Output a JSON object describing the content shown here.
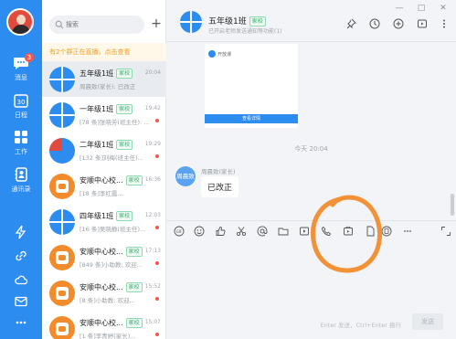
{
  "colors": {
    "nav_blue": "#2d8cf0",
    "tag_green": "#2fb36b",
    "unread_red": "#f5554a",
    "annotation_orange": "#f28b2c"
  },
  "nav": {
    "badge": "3",
    "items": [
      {
        "label": "消息",
        "icon": "chat-bubble-icon"
      },
      {
        "label": "日程",
        "icon": "calendar-30-icon"
      },
      {
        "label": "工作",
        "icon": "apps-grid-icon"
      },
      {
        "label": "通讯录",
        "icon": "contacts-book-icon"
      }
    ],
    "bottom_icons": [
      "lightning-icon",
      "link-icon",
      "cloud-icon",
      "mail-icon",
      "more-dots-icon"
    ]
  },
  "list": {
    "search_placeholder": "搜索",
    "add_label": "+",
    "banner": "有2个群正在直播，点击查看",
    "conversations": [
      {
        "name": "五年级1班",
        "tag": "家校",
        "time": "20:04",
        "preview": "周晨致(家长): 已改正",
        "avatar": "grid",
        "unread": false,
        "active": true
      },
      {
        "name": "一年级1班",
        "tag": "家校",
        "time": "19:42",
        "preview": "[78 条]张晓芳(班主任): ...",
        "avatar": "grid",
        "unread": true,
        "active": false
      },
      {
        "name": "二年级1班",
        "tag": "家校",
        "time": "19:29",
        "preview": "[132 条]刘梅(班主任)...",
        "avatar": "photo",
        "unread": true,
        "active": false
      },
      {
        "name": "安顺中心校...",
        "tag": "家校",
        "time": "16:36",
        "preview": "[18 条]李红霞...",
        "avatar": "orange",
        "unread": false,
        "active": false
      },
      {
        "name": "四年级1班",
        "tag": "家校",
        "time": "12:03",
        "preview": "[16 条]吴晓静(班主任)...",
        "avatar": "grid",
        "unread": true,
        "active": false
      },
      {
        "name": "安顺中心校...",
        "tag": "家校",
        "time": "17:13",
        "preview": "[849 条]小助教: 欢迎...",
        "avatar": "orange",
        "unread": true,
        "active": false
      },
      {
        "name": "安顺中心校...",
        "tag": "家校",
        "time": "15:52",
        "preview": "[8 条]小助教: 欢迎...",
        "avatar": "orange",
        "unread": true,
        "active": false
      },
      {
        "name": "安顺中心校...",
        "tag": "家校",
        "time": "15:07",
        "preview": "[1 条]李青婷(家长)...",
        "avatar": "orange",
        "unread": true,
        "active": false
      }
    ]
  },
  "chat": {
    "title": "五年级1班",
    "title_tag": "家校",
    "subtitle": "已开启老师发送通知等功能(1)",
    "header_icons": [
      "pin-icon",
      "clock-icon",
      "add-member-icon",
      "live-icon",
      "more-icon"
    ],
    "window_controls": [
      "—",
      "□",
      "✕"
    ],
    "card": {
      "brand": "开放课",
      "button": "查看详情"
    },
    "time_separator": "今天 20:04",
    "message": {
      "sender_avatar": "周晨致",
      "sender": "周晨致(家长)",
      "text": "已改正"
    },
    "toolbar_icons": [
      "gif-icon",
      "emoji-icon",
      "thumbs-up-icon",
      "scissors-icon",
      "at-icon",
      "folder-icon",
      "video-icon",
      "phone-icon",
      "live-stream-icon",
      "doc-icon",
      "copy-icon",
      "more-dots-icon"
    ],
    "input_hint": "Enter 发送，Ctrl+Enter 换行",
    "send_label": "发送"
  }
}
